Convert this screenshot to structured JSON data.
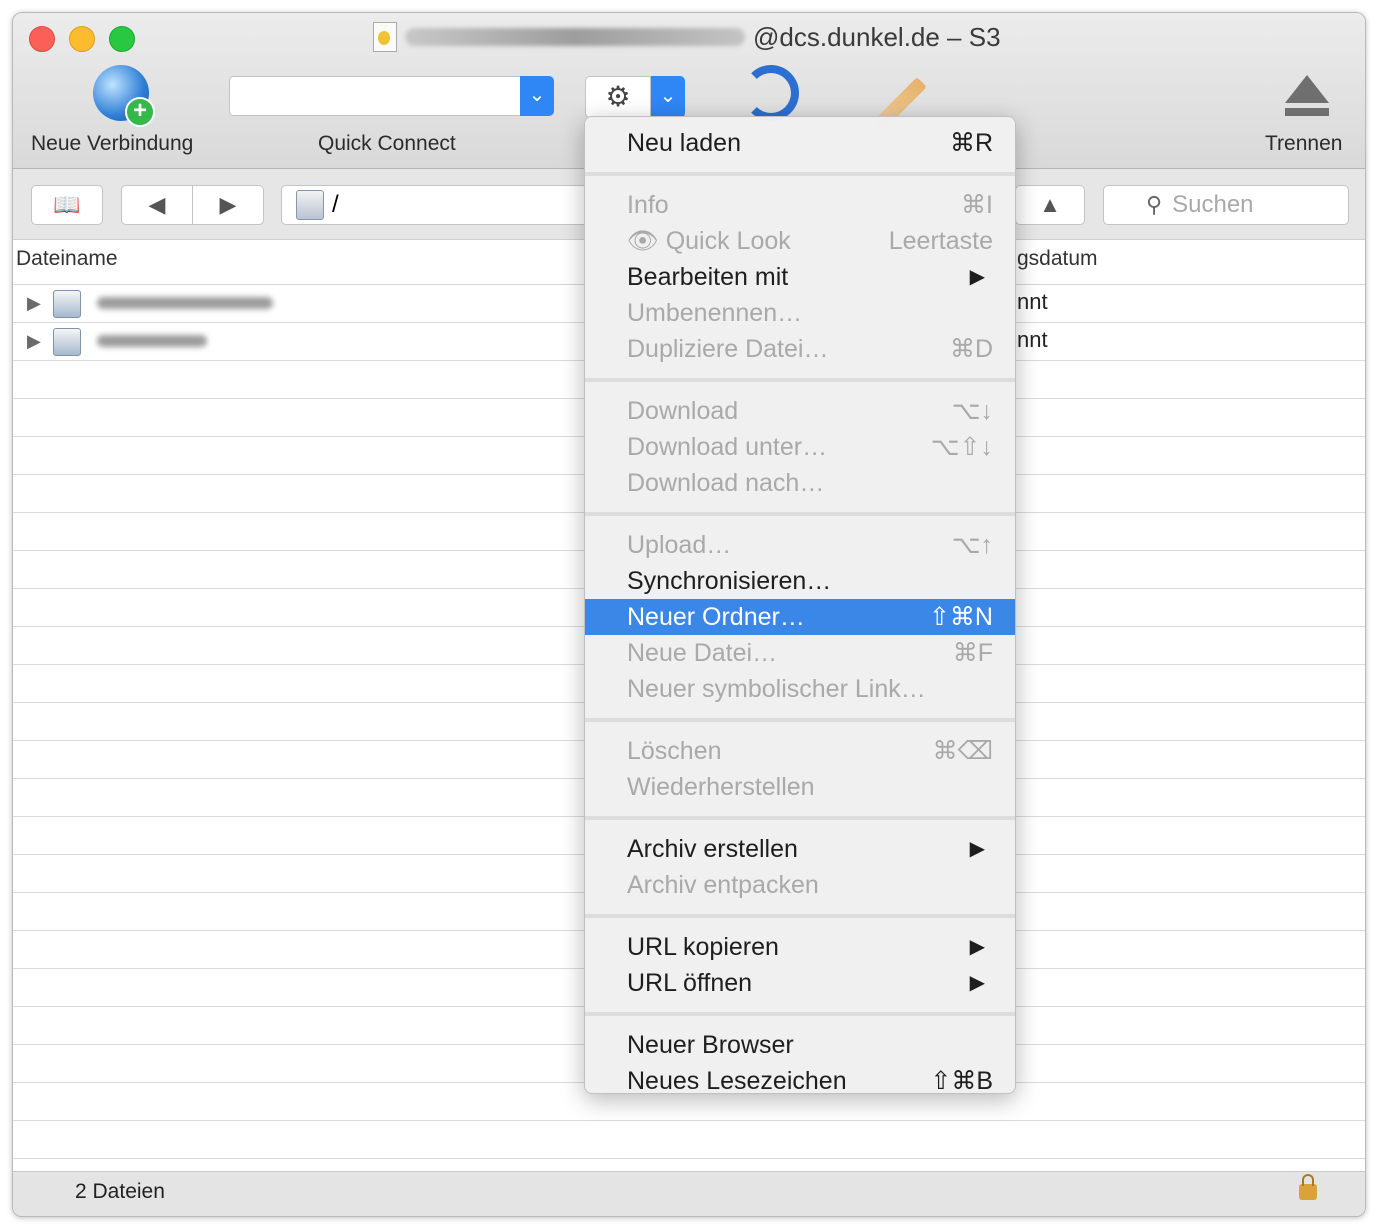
{
  "window": {
    "title_suffix": "@dcs.dunkel.de – S3"
  },
  "toolbar": {
    "new_connection": "Neue Verbindung",
    "quick_connect": "Quick Connect",
    "disconnect": "Trennen"
  },
  "navbar": {
    "path": "/",
    "search_placeholder": "Suchen"
  },
  "table": {
    "columns": [
      "Dateiname",
      "gsdatum"
    ],
    "rows": [
      {
        "date": "nnt"
      },
      {
        "date": "nnt"
      }
    ]
  },
  "status": {
    "file_count": "2 Dateien"
  },
  "menu": {
    "items": [
      {
        "label": "Neu laden",
        "shortcut": "⌘R",
        "enabled": true
      },
      {
        "label": "Info",
        "shortcut": "⌘I",
        "enabled": false
      },
      {
        "label": "Quick Look",
        "shortcut": "Leertaste",
        "enabled": false
      },
      {
        "label": "Bearbeiten mit",
        "submenu": true,
        "enabled": true
      },
      {
        "label": "Umbenennen…",
        "enabled": false
      },
      {
        "label": "Dupliziere Datei…",
        "shortcut": "⌘D",
        "enabled": false
      },
      {
        "label": "Download",
        "shortcut": "⌥↓",
        "enabled": false
      },
      {
        "label": "Download unter…",
        "shortcut": "⌥⇧↓",
        "enabled": false
      },
      {
        "label": "Download nach…",
        "enabled": false
      },
      {
        "label": "Upload…",
        "shortcut": "⌥↑",
        "enabled": false
      },
      {
        "label": "Synchronisieren…",
        "enabled": true
      },
      {
        "label": "Neuer Ordner…",
        "shortcut": "⇧⌘N",
        "enabled": true,
        "selected": true
      },
      {
        "label": "Neue Datei…",
        "shortcut": "⌘F",
        "enabled": false
      },
      {
        "label": "Neuer symbolischer Link…",
        "enabled": false
      },
      {
        "label": "Löschen",
        "shortcut": "⌘⌫",
        "enabled": false
      },
      {
        "label": "Wiederherstellen",
        "enabled": false
      },
      {
        "label": "Archiv erstellen",
        "submenu": true,
        "enabled": true
      },
      {
        "label": "Archiv entpacken",
        "enabled": false
      },
      {
        "label": "URL kopieren",
        "submenu": true,
        "enabled": true
      },
      {
        "label": "URL öffnen",
        "submenu": true,
        "enabled": true
      },
      {
        "label": "Neuer Browser",
        "enabled": true
      },
      {
        "label": "Neues Lesezeichen",
        "shortcut": "⇧⌘B",
        "enabled": true
      }
    ]
  },
  "colors": {
    "accent": "#3a87e8",
    "toolbar_dropdown": "#2f86f5"
  },
  "icons": {
    "submenu": "submenu-arrow-icon",
    "quick_look": "eye-icon"
  }
}
